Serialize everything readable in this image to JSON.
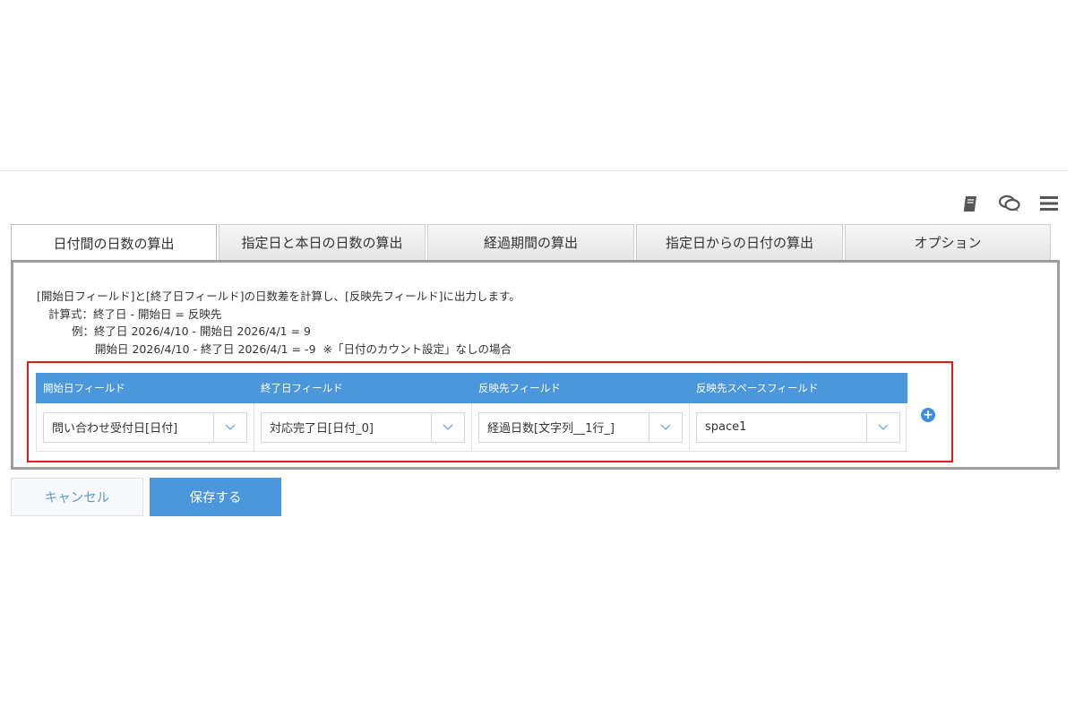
{
  "toolbar": {
    "icons": [
      "book-icon",
      "chat-bubbles-icon",
      "hamburger-menu-icon"
    ]
  },
  "tabs": [
    {
      "label": "日付間の日数の算出",
      "active": true
    },
    {
      "label": "指定日と本日の日数の算出",
      "active": false
    },
    {
      "label": "経過期間の算出",
      "active": false
    },
    {
      "label": "指定日からの日付の算出",
      "active": false
    },
    {
      "label": "オプション",
      "active": false
    }
  ],
  "description": {
    "line1": "[開始日フィールド]と[終了日フィールド]の日数差を計算し、[反映先フィールド]に出力します。",
    "line2": "計算式：終了日 - 開始日 = 反映先",
    "line3": "例：終了日 2026/4/10 - 開始日 2026/4/1 = 9",
    "line4": "開始日 2026/4/10 - 終了日 2026/4/1 = -9  ※「日付のカウント設定」なしの場合"
  },
  "grid": {
    "headers": [
      "開始日フィールド",
      "終了日フィールド",
      "反映先フィールド",
      "反映先スペースフィールド"
    ],
    "values": [
      "問い合わせ受付日[日付]",
      "対応完了日[日付_0]",
      "経過日数[文字列__1行_]",
      "space1"
    ]
  },
  "add_button": "+",
  "buttons": {
    "cancel": "キャンセル",
    "save": "保存する"
  },
  "colors": {
    "accent": "#4a97dd",
    "highlight_border": "#e01b1b",
    "panel_border": "#9e9e9e"
  }
}
